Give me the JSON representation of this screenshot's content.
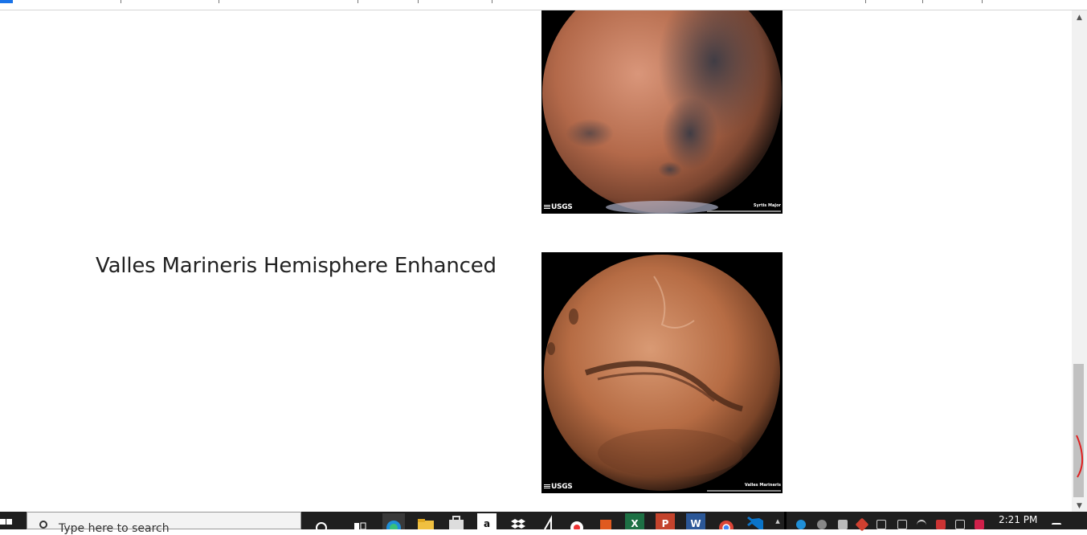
{
  "hemispheres": [
    {
      "title": "",
      "image_caption": "Syrtis Major",
      "watermark": "USGS"
    },
    {
      "title": "Valles Marineris Hemisphere Enhanced",
      "image_caption": "Valles Marineris",
      "watermark": "USGS"
    }
  ],
  "taskbar": {
    "search_placeholder": "Type here to search",
    "apps": [
      "cortana-icon",
      "task-view-icon",
      "edge-icon",
      "file-explorer-icon",
      "store-icon",
      "amazon-icon",
      "dropbox-icon",
      "vs-icon",
      "itunes-icon",
      "office-icon",
      "excel-icon",
      "powerpoint-icon",
      "word-icon",
      "chrome-icon",
      "vscode-icon"
    ],
    "app_glyphs": {
      "amazon": "a",
      "excel": "X",
      "powerpoint": "P",
      "word": "W"
    },
    "clock": "2:21 PM"
  },
  "colors": {
    "taskbar": "#1f1f1f",
    "edge": "#1f8fd8",
    "excel": "#1d7044",
    "powerpoint": "#c4432c",
    "word": "#2b5797",
    "vscode": "#0a74c9"
  }
}
